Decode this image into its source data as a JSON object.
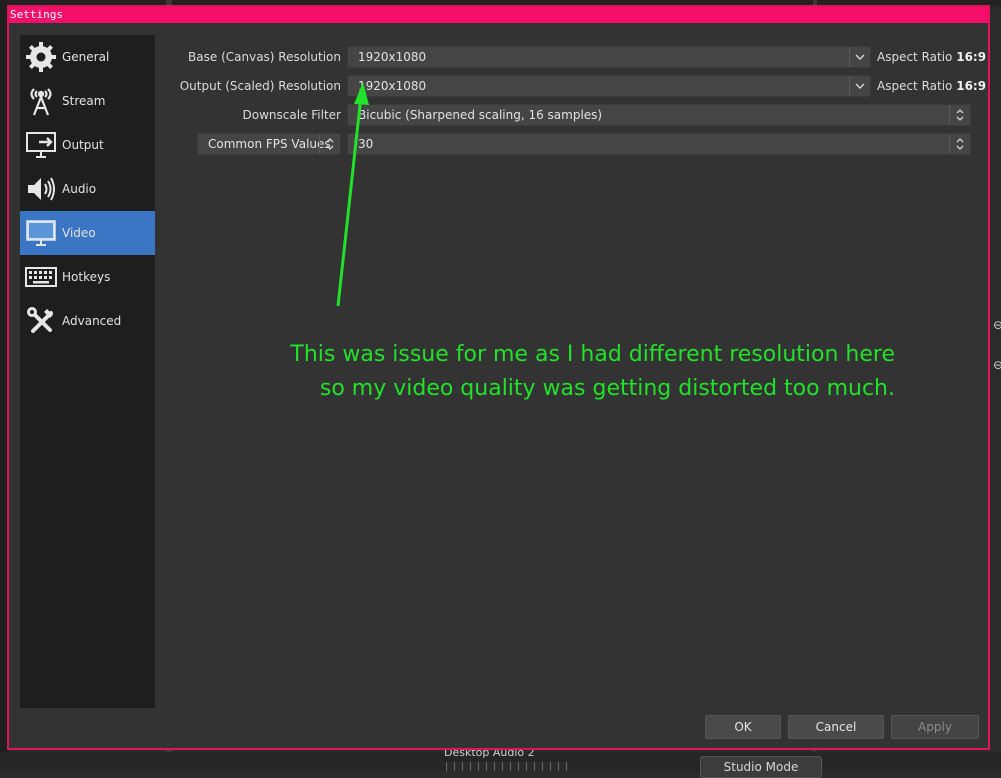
{
  "window": {
    "title": "Settings"
  },
  "sidebar": {
    "items": [
      {
        "label": "General",
        "icon": "gear-icon",
        "active": false
      },
      {
        "label": "Stream",
        "icon": "broadcast-antenna-icon",
        "active": false
      },
      {
        "label": "Output",
        "icon": "monitor-output-icon",
        "active": false
      },
      {
        "label": "Audio",
        "icon": "speaker-icon",
        "active": false
      },
      {
        "label": "Video",
        "icon": "monitor-icon",
        "active": true
      },
      {
        "label": "Hotkeys",
        "icon": "keyboard-icon",
        "active": false
      },
      {
        "label": "Advanced",
        "icon": "tools-icon",
        "active": false
      }
    ]
  },
  "video": {
    "base_label": "Base (Canvas) Resolution",
    "base_value": "1920x1080",
    "base_aspect_prefix": "Aspect Ratio",
    "base_aspect_value": "16:9",
    "output_label": "Output (Scaled) Resolution",
    "output_value": "1920x1080",
    "output_aspect_prefix": "Aspect Ratio",
    "output_aspect_value": "16:9",
    "filter_label": "Downscale Filter",
    "filter_value": "Bicubic (Sharpened scaling, 16 samples)",
    "fps_type": "Common FPS Values",
    "fps_value": "30"
  },
  "annotation": {
    "line1": "This was issue for me as I had different resolution here",
    "line2": "so my video quality was getting distorted too much.",
    "color": "#22e12a"
  },
  "buttons": {
    "ok": "OK",
    "cancel": "Cancel",
    "apply": "Apply"
  },
  "background": {
    "mixer_label": "Desktop Audio 2",
    "studio_mode": "Studio Mode"
  },
  "colors": {
    "titlebar": "#f50f6a",
    "active_item": "#3a76c3",
    "annotation": "#22e12a"
  }
}
